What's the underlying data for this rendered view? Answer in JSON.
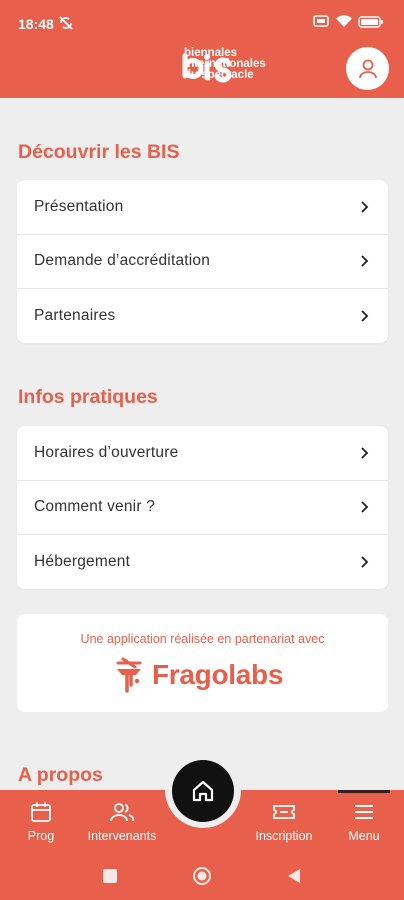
{
  "status_bar": {
    "time": "18:48"
  },
  "header": {
    "logo_text_line1": "biennales",
    "logo_text_line2": "internationales",
    "logo_text_line3": "du spectacle"
  },
  "sections": [
    {
      "title": "Découvrir les BIS",
      "items": [
        {
          "label": "Présentation"
        },
        {
          "label": "Demande d’accréditation"
        },
        {
          "label": "Partenaires"
        }
      ]
    },
    {
      "title": "Infos pratiques",
      "items": [
        {
          "label": "Horaires d’ouverture"
        },
        {
          "label": "Comment venir ?"
        },
        {
          "label": "Hébergement"
        }
      ]
    }
  ],
  "partner": {
    "text": "Une application réalisée en partenariat avec",
    "brand": "Fragolabs"
  },
  "about_title": "A propos",
  "bottom_nav": {
    "prog": "Prog",
    "intervenants": "Intervenants",
    "inscription": "Inscription",
    "menu": "Menu"
  },
  "colors": {
    "accent": "#e8604c",
    "background": "#eeeeee",
    "home_button": "#111111"
  },
  "icons": [
    "logo-bis-icon",
    "user-icon",
    "chevron-right-icon",
    "fragolabs-logo-icon",
    "calendar-icon",
    "people-icon",
    "home-icon",
    "ticket-icon",
    "menu-icon"
  ]
}
